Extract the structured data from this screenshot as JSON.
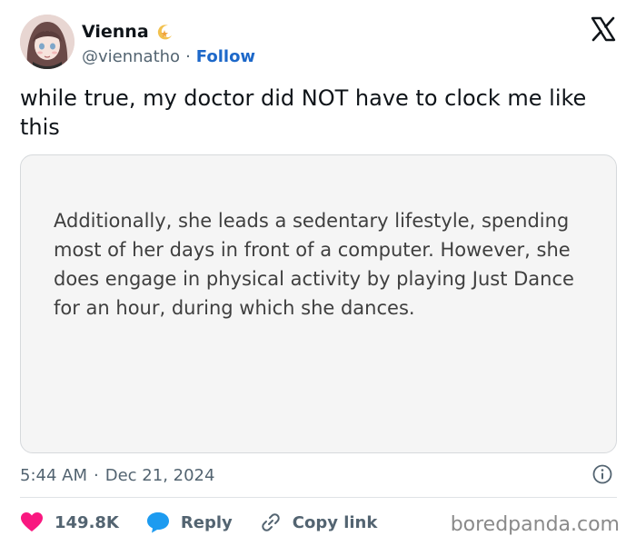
{
  "author": {
    "display_name": "Vienna",
    "handle": "@viennatho",
    "separator": "·",
    "follow_label": "Follow",
    "badge_icon": "crescent-moon-star-icon"
  },
  "tweet": {
    "text": "while true, my doctor did NOT have to clock me like this"
  },
  "media": {
    "text": "Additionally, she leads a sedentary lifestyle, spending most of her days in front of a computer. However, she does engage in physical activity by playing Just Dance for an hour, during which she dances."
  },
  "meta": {
    "time": "5:44 AM",
    "separator": "·",
    "date": "Dec 21, 2024"
  },
  "actions": {
    "likes": "149.8K",
    "reply_label": "Reply",
    "copy_link_label": "Copy link"
  },
  "watermark": "boredpanda.com",
  "colors": {
    "heart": "#f91880",
    "reply_bubble": "#1d9bf0",
    "follow": "#1d68c9",
    "muted": "#536471"
  }
}
